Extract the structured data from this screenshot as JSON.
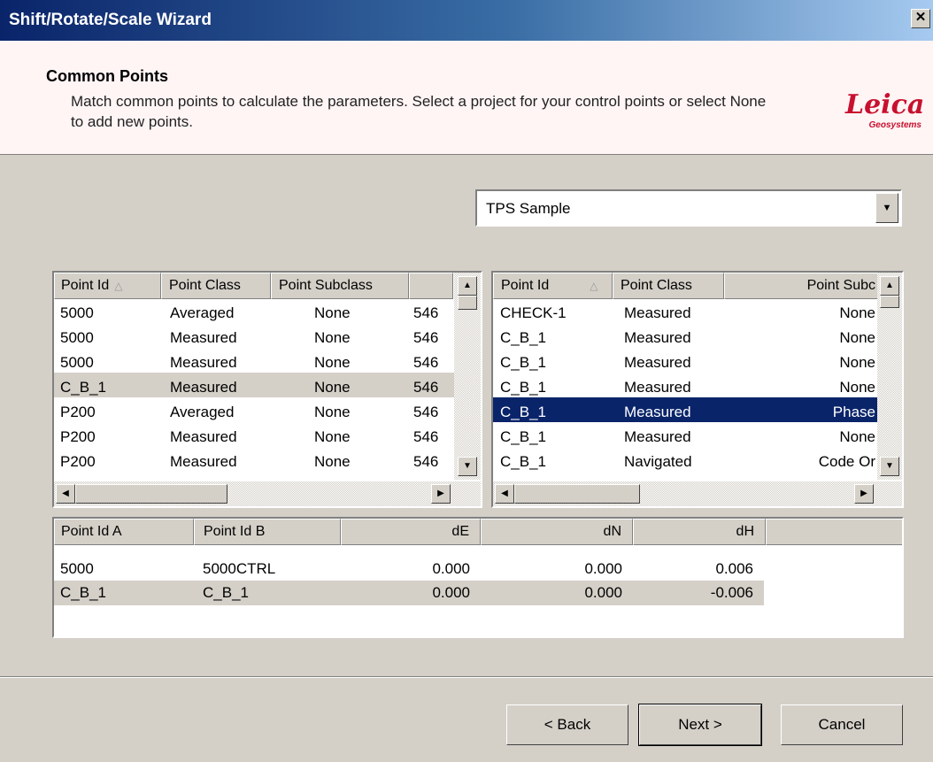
{
  "window": {
    "title": "Shift/Rotate/Scale Wizard",
    "close_label": "✕"
  },
  "header": {
    "title": "Common Points",
    "description": "Match common points to calculate the parameters. Select a project for your control points or select None to add new points.",
    "logo_main": "Leica",
    "logo_sub": "Geosystems"
  },
  "project_select": {
    "value": "TPS Sample"
  },
  "left_grid": {
    "columns": [
      "Point Id",
      "Point Class",
      "Point Subclass",
      ""
    ],
    "rows": [
      [
        "5000",
        "Averaged",
        "None",
        "546"
      ],
      [
        "5000",
        "Measured",
        "None",
        "546"
      ],
      [
        "5000",
        "Measured",
        "None",
        "546"
      ],
      [
        "C_B_1",
        "Measured",
        "None",
        "546"
      ],
      [
        "P200",
        "Averaged",
        "None",
        "546"
      ],
      [
        "P200",
        "Measured",
        "None",
        "546"
      ],
      [
        "P200",
        "Measured",
        "None",
        "546"
      ]
    ]
  },
  "right_grid": {
    "columns": [
      "Point Id",
      "Point Class",
      "Point Subc"
    ],
    "rows": [
      [
        "CHECK-1",
        "Measured",
        "None"
      ],
      [
        "C_B_1",
        "Measured",
        "None"
      ],
      [
        "C_B_1",
        "Measured",
        "None"
      ],
      [
        "C_B_1",
        "Measured",
        "None"
      ],
      [
        "C_B_1",
        "Measured",
        "Phase"
      ],
      [
        "C_B_1",
        "Measured",
        "None"
      ],
      [
        "C_B_1",
        "Navigated",
        "Code Or"
      ]
    ]
  },
  "match_grid": {
    "columns": [
      "Point Id A",
      "Point Id B",
      "dE",
      "dN",
      "dH"
    ],
    "rows": [
      [
        "5000",
        "5000CTRL",
        "0.000",
        "0.000",
        "0.006"
      ],
      [
        "C_B_1",
        "C_B_1",
        "0.000",
        "0.000",
        "-0.006"
      ]
    ]
  },
  "buttons": {
    "back": "< Back",
    "next": "Next >",
    "cancel": "Cancel"
  },
  "colors": {
    "selection": "#0a246a",
    "row_highlight": "#d4d0c8",
    "header_bg": "#fff5f5",
    "brand": "#c8102e"
  }
}
